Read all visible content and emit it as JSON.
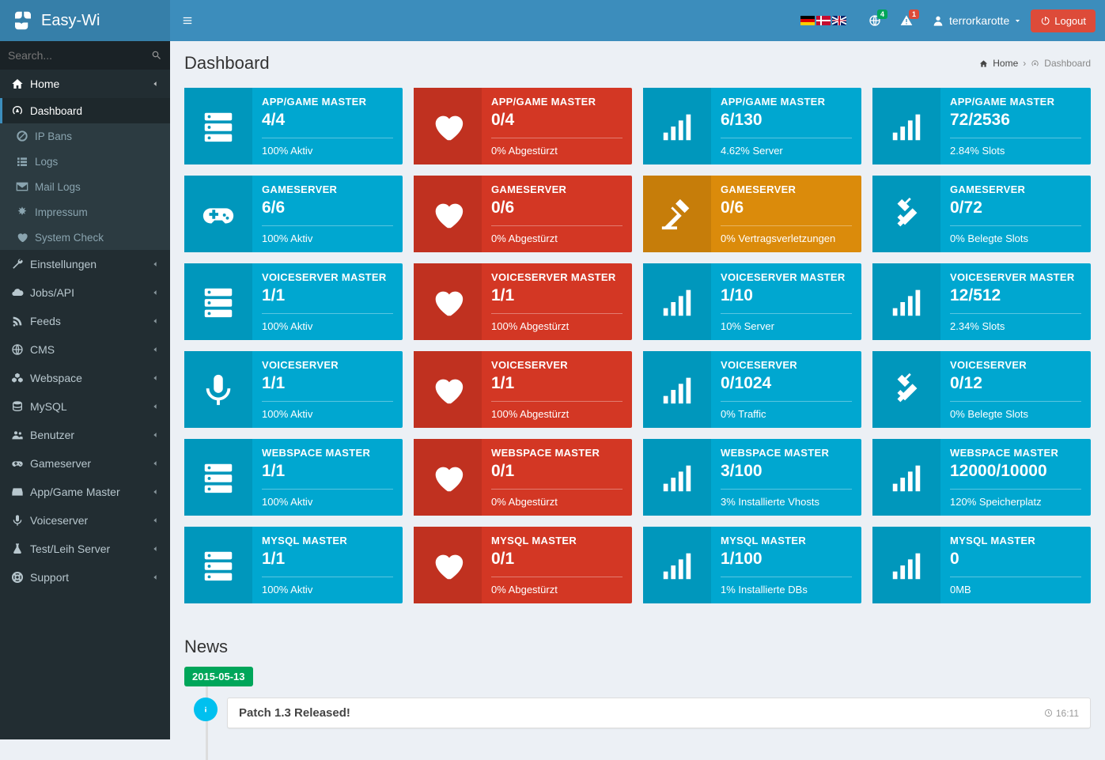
{
  "brand": "Easy-Wi",
  "search": {
    "placeholder": "Search..."
  },
  "header": {
    "notifications_badge": "4",
    "warnings_badge": "1",
    "username": "terrorkarotte",
    "logout": "Logout"
  },
  "breadcrumb": {
    "home": "Home",
    "current": "Dashboard"
  },
  "page_title": "Dashboard",
  "sidebar": {
    "home": "Home",
    "sub": [
      {
        "icon": "dash",
        "label": "Dashboard",
        "active": true
      },
      {
        "icon": "ban",
        "label": "IP Bans"
      },
      {
        "icon": "list",
        "label": "Logs"
      },
      {
        "icon": "mail",
        "label": "Mail Logs"
      },
      {
        "icon": "legal",
        "label": "Impressum"
      },
      {
        "icon": "heart",
        "label": "System Check"
      }
    ],
    "main": [
      {
        "icon": "wrench",
        "label": "Einstellungen"
      },
      {
        "icon": "cloud",
        "label": "Jobs/API"
      },
      {
        "icon": "rss",
        "label": "Feeds"
      },
      {
        "icon": "globe",
        "label": "CMS"
      },
      {
        "icon": "cubes",
        "label": "Webspace"
      },
      {
        "icon": "db",
        "label": "MySQL"
      },
      {
        "icon": "users",
        "label": "Benutzer"
      },
      {
        "icon": "gamepad",
        "label": "Gameserver"
      },
      {
        "icon": "hdd",
        "label": "App/Game Master"
      },
      {
        "icon": "mic",
        "label": "Voiceserver"
      },
      {
        "icon": "flask",
        "label": "Test/Leih Server"
      },
      {
        "icon": "life",
        "label": "Support"
      }
    ]
  },
  "cards": [
    [
      {
        "icon": "server",
        "title": "APP/GAME MASTER",
        "value": "4/4",
        "footer": "100% Aktiv",
        "bg": "lb"
      },
      {
        "icon": "heart",
        "title": "APP/GAME MASTER",
        "value": "0/4",
        "footer": "0% Abgestürzt",
        "bg": "red"
      },
      {
        "icon": "signal",
        "title": "APP/GAME MASTER",
        "value": "6/130",
        "footer": "4.62% Server",
        "bg": "lb"
      },
      {
        "icon": "signal",
        "title": "APP/GAME MASTER",
        "value": "72/2536",
        "footer": "2.84% Slots",
        "bg": "lb"
      }
    ],
    [
      {
        "icon": "gamepad",
        "title": "GAMESERVER",
        "value": "6/6",
        "footer": "100% Aktiv",
        "bg": "lb"
      },
      {
        "icon": "heart",
        "title": "GAMESERVER",
        "value": "0/6",
        "footer": "0% Abgestürzt",
        "bg": "red"
      },
      {
        "icon": "gavel",
        "title": "GAMESERVER",
        "value": "0/6",
        "footer": "0% Vertragsverletzungen",
        "bg": "yellow"
      },
      {
        "icon": "plug",
        "title": "GAMESERVER",
        "value": "0/72",
        "footer": "0% Belegte Slots",
        "bg": "lb"
      }
    ],
    [
      {
        "icon": "server",
        "title": "VOICESERVER MASTER",
        "value": "1/1",
        "footer": "100% Aktiv",
        "bg": "lb"
      },
      {
        "icon": "heart",
        "title": "VOICESERVER MASTER",
        "value": "1/1",
        "footer": "100% Abgestürzt",
        "bg": "red"
      },
      {
        "icon": "signal",
        "title": "VOICESERVER MASTER",
        "value": "1/10",
        "footer": "10% Server",
        "bg": "lb"
      },
      {
        "icon": "signal",
        "title": "VOICESERVER MASTER",
        "value": "12/512",
        "footer": "2.34% Slots",
        "bg": "lb"
      }
    ],
    [
      {
        "icon": "mic",
        "title": "VOICESERVER",
        "value": "1/1",
        "footer": "100% Aktiv",
        "bg": "lb"
      },
      {
        "icon": "heart",
        "title": "VOICESERVER",
        "value": "1/1",
        "footer": "100% Abgestürzt",
        "bg": "red"
      },
      {
        "icon": "signal",
        "title": "VOICESERVER",
        "value": "0/1024",
        "footer": "0% Traffic",
        "bg": "lb"
      },
      {
        "icon": "plug",
        "title": "VOICESERVER",
        "value": "0/12",
        "footer": "0% Belegte Slots",
        "bg": "lb"
      }
    ],
    [
      {
        "icon": "server",
        "title": "WEBSPACE MASTER",
        "value": "1/1",
        "footer": "100% Aktiv",
        "bg": "lb"
      },
      {
        "icon": "heart",
        "title": "WEBSPACE MASTER",
        "value": "0/1",
        "footer": "0% Abgestürzt",
        "bg": "red"
      },
      {
        "icon": "signal",
        "title": "WEBSPACE MASTER",
        "value": "3/100",
        "footer": "3% Installierte Vhosts",
        "bg": "lb"
      },
      {
        "icon": "signal",
        "title": "WEBSPACE MASTER",
        "value": "12000/10000",
        "footer": "120% Speicherplatz",
        "bg": "lb"
      }
    ],
    [
      {
        "icon": "server",
        "title": "MYSQL MASTER",
        "value": "1/1",
        "footer": "100% Aktiv",
        "bg": "lb"
      },
      {
        "icon": "heart",
        "title": "MYSQL MASTER",
        "value": "0/1",
        "footer": "0% Abgestürzt",
        "bg": "red"
      },
      {
        "icon": "signal",
        "title": "MYSQL MASTER",
        "value": "1/100",
        "footer": "1% Installierte DBs",
        "bg": "lb"
      },
      {
        "icon": "signal",
        "title": "MYSQL MASTER",
        "value": "0",
        "footer": "0MB",
        "bg": "lb"
      }
    ]
  ],
  "news": {
    "heading": "News",
    "date": "2015-05-13",
    "item_title": "Patch 1.3 Released!",
    "item_time": "16:11"
  }
}
